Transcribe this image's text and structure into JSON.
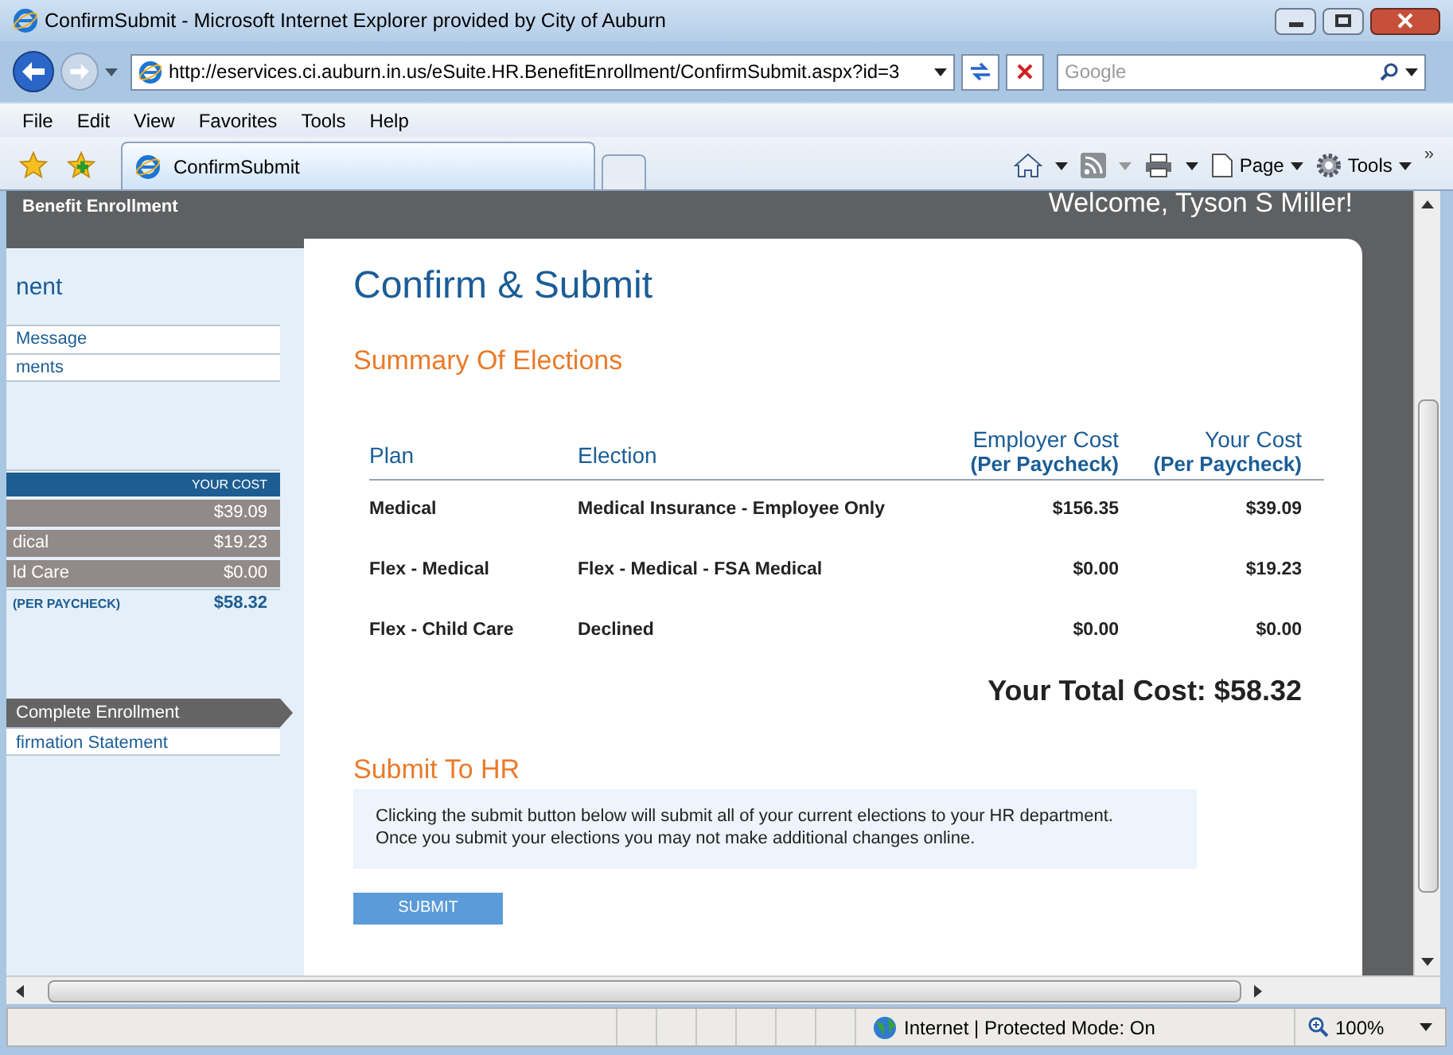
{
  "window": {
    "title": "ConfirmSubmit - Microsoft Internet Explorer provided by City of Auburn"
  },
  "address_bar": {
    "url": "http://eservices.ci.auburn.in.us/eSuite.HR.BenefitEnrollment/ConfirmSubmit.aspx?id=3"
  },
  "search": {
    "placeholder": "Google"
  },
  "menu": [
    "File",
    "Edit",
    "View",
    "Favorites",
    "Tools",
    "Help"
  ],
  "tabs": [
    {
      "label": "ConfirmSubmit",
      "selected": true
    }
  ],
  "toolbar": {
    "page": "Page",
    "tools": "Tools",
    "more": "»"
  },
  "header": {
    "title": "Benefit Enrollment",
    "welcome": "Welcome, Tyson S Miller!"
  },
  "sidebar": {
    "heading": "nent",
    "links": [
      "Message",
      "ments"
    ],
    "cost_table": {
      "column": "YOUR COST",
      "rows": [
        {
          "plan": "",
          "cost": "$39.09"
        },
        {
          "plan": "dical",
          "cost": "$19.23"
        },
        {
          "plan": "ld Care",
          "cost": "$0.00"
        }
      ],
      "total_label": "(PER PAYCHECK)",
      "total": "$58.32"
    },
    "steps": [
      {
        "label": "Complete Enrollment",
        "selected": true
      },
      {
        "label": "firmation Statement",
        "selected": false
      }
    ]
  },
  "main": {
    "title": "Confirm & Submit",
    "summary_heading": "Summary Of Elections",
    "columns": [
      {
        "label": "Plan"
      },
      {
        "label": "Election"
      },
      {
        "label": "Employer Cost",
        "sub": "(Per Paycheck)"
      },
      {
        "label": "Your Cost",
        "sub": "(Per Paycheck)"
      }
    ],
    "rows": [
      {
        "plan": "Medical",
        "election": "Medical Insurance - Employee Only",
        "employer": "$156.35",
        "yours": "$39.09"
      },
      {
        "plan": "Flex - Medical",
        "election": "Flex - Medical - FSA Medical",
        "employer": "$0.00",
        "yours": "$19.23"
      },
      {
        "plan": "Flex - Child Care",
        "election": "Declined",
        "employer": "$0.00",
        "yours": "$0.00"
      }
    ],
    "total": "Your Total Cost: $58.32",
    "submit_heading": "Submit To HR",
    "notice": [
      "Clicking the submit button below will submit all of your current elections to your HR department.",
      "Once you submit your elections you may not make additional changes online."
    ],
    "submit_button": "SUBMIT"
  },
  "status_bar": {
    "zone": "Internet | Protected Mode: On",
    "zoom": "100%"
  }
}
